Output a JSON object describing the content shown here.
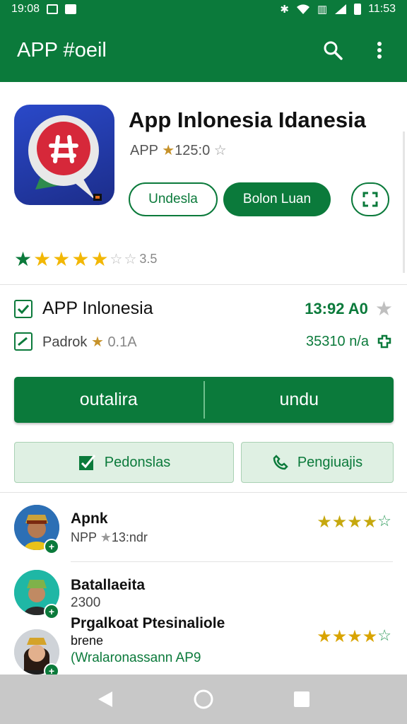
{
  "status_bar": {
    "time_left": "19:08",
    "time_right": "11:53"
  },
  "app_bar": {
    "title": "APP #oeil",
    "search_icon": "search-icon",
    "menu_icon": "more-vert-icon"
  },
  "app": {
    "title": "App Inlonesia Idanesia",
    "sub_prefix": "APP",
    "sub_star": "★",
    "sub_value": "125:0",
    "sub_star_empty": "☆",
    "btn_outline": "Undesla",
    "btn_fill": "Bolon Luan",
    "btn_icon": "expand-icon",
    "rating_text": "3.5"
  },
  "info": {
    "row1_label": "APP Inlonesia",
    "row1_value": "13:92 A0",
    "row2_label": "Padrok",
    "row2_star": "★",
    "row2_value_small": "0.1A",
    "row2_value": "35310 n/a"
  },
  "split_button": {
    "left": "outalira",
    "right": "undu"
  },
  "light_buttons": {
    "left": "Pedonslas",
    "right": "Pengiuajis"
  },
  "list": [
    {
      "name": "Apnk",
      "sub_prefix": "NPP",
      "sub_star": "★",
      "sub_value": "13:ndr",
      "stars": 4.5
    },
    {
      "name": "Batallaeita",
      "sub": "2300"
    },
    {
      "name": "Prgalkoat Ptesinaliole",
      "name2": "brene",
      "link": "(Wralaronassann AP9",
      "stars": 4.5
    }
  ],
  "colors": {
    "primary": "#0b7a3b",
    "gold": "#f2b705",
    "nav_bg": "#c8c8c8"
  }
}
